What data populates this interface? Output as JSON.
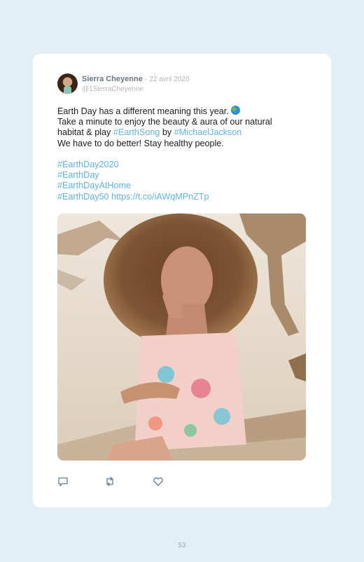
{
  "tweet": {
    "author": "Sierra Cheyenne",
    "separator": "·",
    "date": "22 avril 2020",
    "handle": "@1SierraCheyenne",
    "lines": {
      "l1": "Earth Day has a different meaning this year.",
      "l2": "Take a minute to enjoy the beauty & aura of our natural",
      "l3_pre": "habitat & play ",
      "l3_tag1": "#EarthSong",
      "l3_mid": " by ",
      "l3_tag2": "#MichaelJackson",
      "l4": "We have to do better! Stay healthy people."
    },
    "hashtags": {
      "h1": "#EarthDay2020",
      "h2": "#EarthDay",
      "h3": "#EarthDayAtHome",
      "h4": "#EarthDay50",
      "link": "https://t.co/iAWqMPnZTp"
    },
    "emoji_icon": "globe-icon",
    "actions": [
      "reply-icon",
      "retweet-icon",
      "like-icon"
    ]
  },
  "page": {
    "number": "53"
  },
  "colors": {
    "background": "#e3eff6",
    "card": "#ffffff",
    "link": "#5eb3e4",
    "meta": "#aeb6bc"
  }
}
